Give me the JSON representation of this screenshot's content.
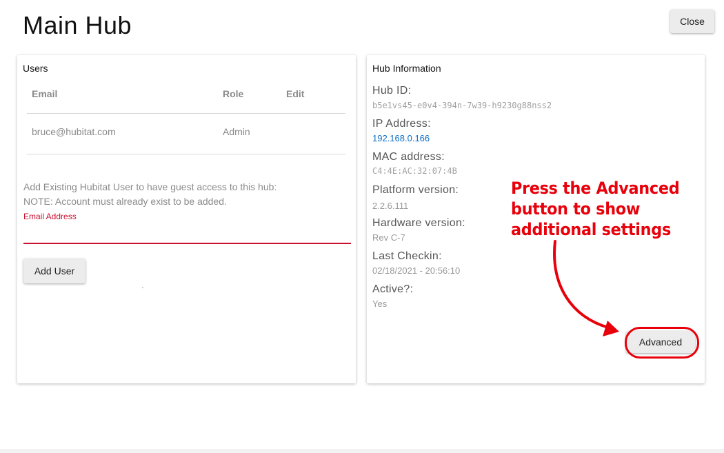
{
  "page": {
    "title": "Main Hub",
    "close_label": "Close"
  },
  "users_card": {
    "title": "Users",
    "columns": [
      "Email",
      "Role",
      "Edit"
    ],
    "rows": [
      {
        "email": "bruce@hubitat.com",
        "role": "Admin"
      }
    ],
    "help_line_1": "Add Existing Hubitat User to have guest access to this hub:",
    "help_line_2": "NOTE: Account must already exist to be added.",
    "email_label": "Email Address",
    "email_value": "",
    "add_user_label": "Add User"
  },
  "hub_card": {
    "title": "Hub Information",
    "hub_id_label": "Hub ID:",
    "hub_id_value": "b5e1vs45-e0v4-394n-7w39-h9230g88nss2",
    "ip_label": "IP Address:",
    "ip_value": "192.168.0.166",
    "mac_label": "MAC address:",
    "mac_value": "C4:4E:AC:32:07:4B",
    "platform_label": "Platform version:",
    "platform_value": "2.2.6.111",
    "hardware_label": "Hardware version:",
    "hardware_value": "Rev C-7",
    "checkin_label": "Last Checkin:",
    "checkin_value": "02/18/2021 - 20:56:10",
    "active_label": "Active?:",
    "active_value": "Yes",
    "advanced_label": "Advanced"
  },
  "annotation": {
    "line_1": "Press the Advanced",
    "line_2": "button to show",
    "line_3": "additional settings",
    "color": "#e8000b"
  },
  "colors": {
    "accent_red": "#c8102e",
    "link_blue": "#0b6fc9"
  }
}
